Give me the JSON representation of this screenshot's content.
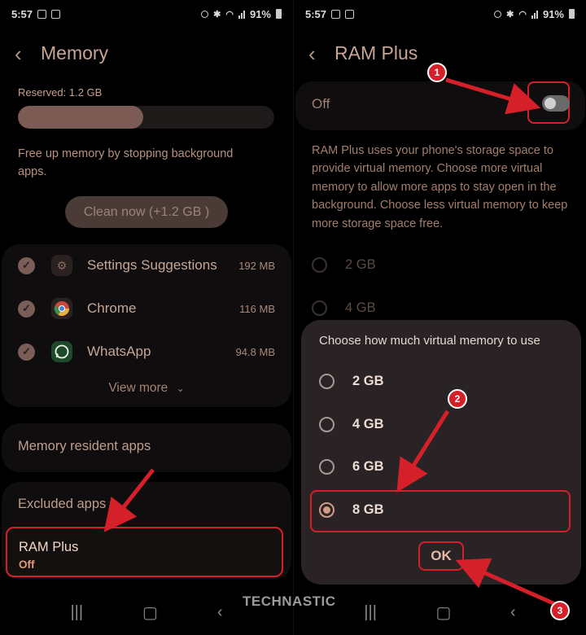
{
  "left": {
    "status": {
      "time": "5:57",
      "battery": "91%"
    },
    "title": "Memory",
    "reserved": "Reserved: 1.2 GB",
    "reserved_fraction": 0.49,
    "freeup_text": "Free up memory by stopping background apps.",
    "clean_label": "Clean now (+1.2 GB )",
    "apps": [
      {
        "name": "Settings Suggestions",
        "size": "192 MB",
        "icon": "settings-suggestions-icon"
      },
      {
        "name": "Chrome",
        "size": "116 MB",
        "icon": "chrome-icon"
      },
      {
        "name": "WhatsApp",
        "size": "94.8 MB",
        "icon": "whatsapp-icon"
      }
    ],
    "view_more": "View more",
    "memory_resident": "Memory resident apps",
    "excluded": "Excluded apps",
    "ram_plus_title": "RAM Plus",
    "ram_plus_status": "Off"
  },
  "right": {
    "status": {
      "time": "5:57",
      "battery": "91%"
    },
    "title": "RAM Plus",
    "toggle_label": "Off",
    "description": "RAM Plus uses your phone's storage space to provide virtual memory. Choose more virtual memory to allow more apps to stay open in the background. Choose less virtual memory to keep more storage space free.",
    "bg_options": [
      "2 GB",
      "4 GB"
    ],
    "dialog": {
      "title": "Choose how much virtual memory to use",
      "options": [
        "2 GB",
        "4 GB",
        "6 GB",
        "8 GB"
      ],
      "selected": "8 GB",
      "ok": "OK"
    }
  },
  "annotations": {
    "badge1": "1",
    "badge2": "2",
    "badge3": "3",
    "watermark": "TECHNASTIC"
  },
  "colors": {
    "accent": "#d29b86",
    "annotation_red": "#d5202a",
    "bar_fill": "#7b5b53"
  }
}
